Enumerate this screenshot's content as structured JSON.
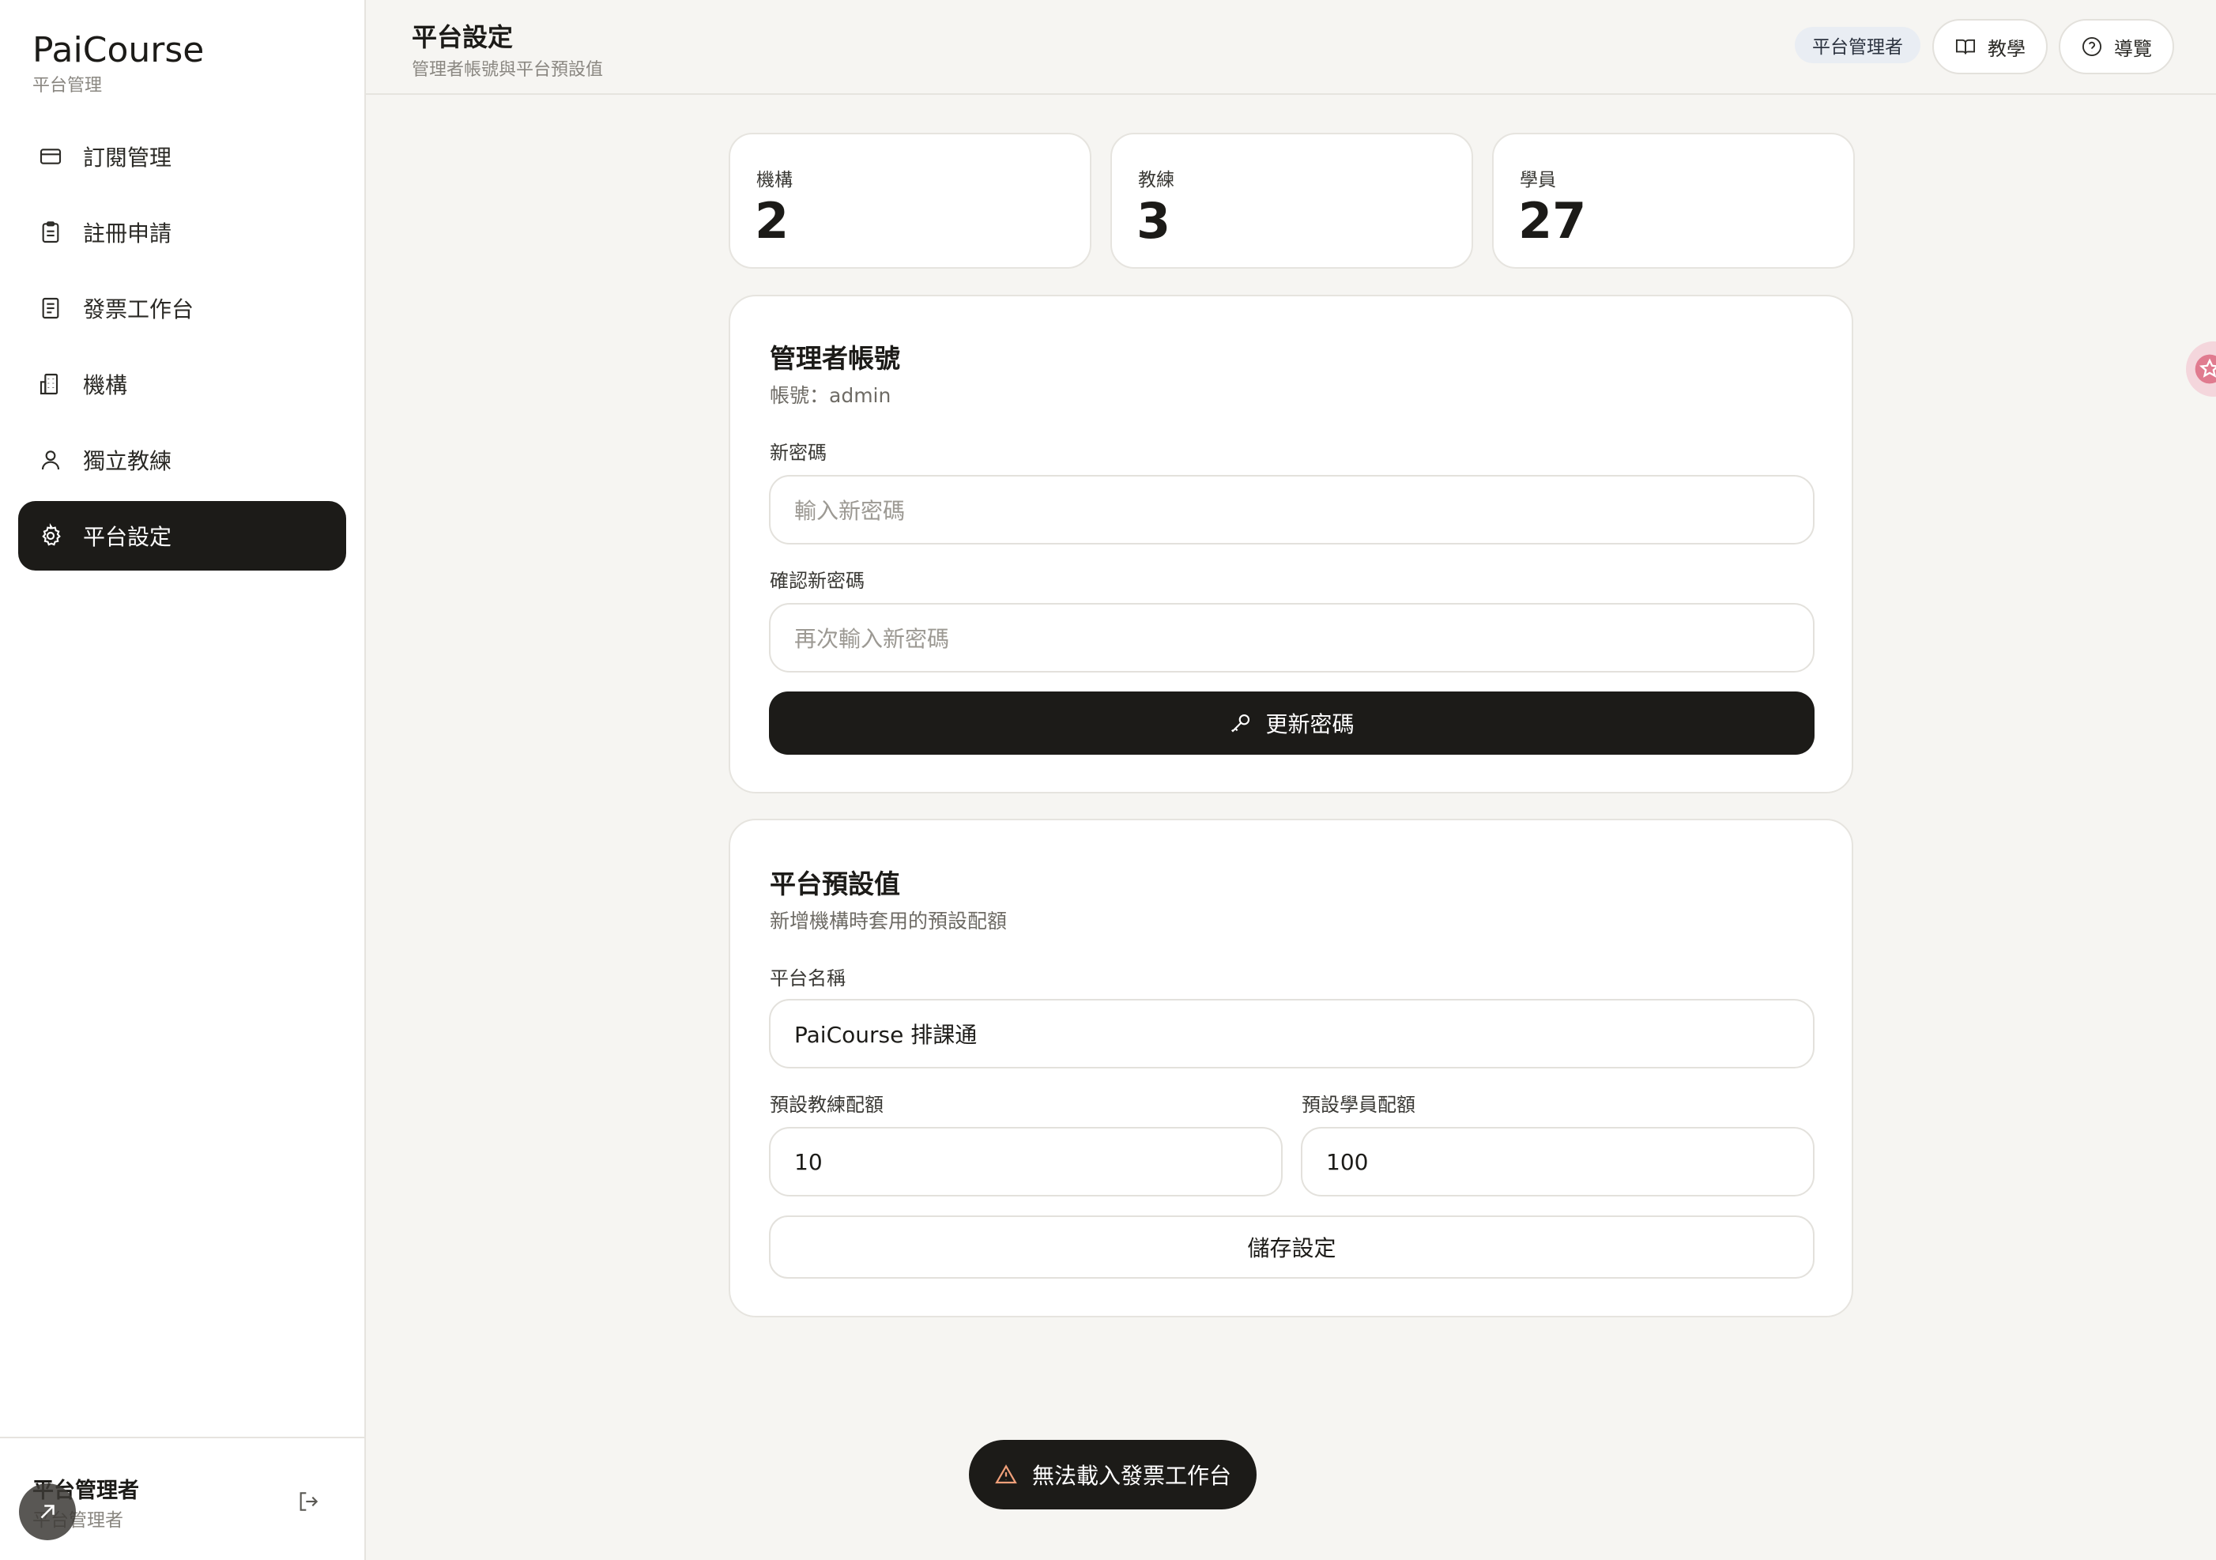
{
  "brand": {
    "title": "PaiCourse",
    "subtitle": "平台管理"
  },
  "sidebar": {
    "items": [
      {
        "label": "訂閱管理",
        "icon": "credit-card-icon",
        "active": false
      },
      {
        "label": "註冊申請",
        "icon": "clipboard-icon",
        "active": false
      },
      {
        "label": "發票工作台",
        "icon": "document-icon",
        "active": false
      },
      {
        "label": "機構",
        "icon": "building-icon",
        "active": false
      },
      {
        "label": "獨立教練",
        "icon": "user-icon",
        "active": false
      },
      {
        "label": "平台設定",
        "icon": "gear-icon",
        "active": true
      }
    ],
    "footer": {
      "name": "平台管理者",
      "role": "平台管理者"
    }
  },
  "header": {
    "title": "平台設定",
    "subtitle": "管理者帳號與平台預設值",
    "badge": "平台管理者",
    "tutorial_label": "教學",
    "tour_label": "導覽"
  },
  "stats": [
    {
      "label": "機構",
      "value": "2"
    },
    {
      "label": "教練",
      "value": "3"
    },
    {
      "label": "學員",
      "value": "27"
    }
  ],
  "admin_account": {
    "title": "管理者帳號",
    "account_line": "帳號：admin",
    "new_password_label": "新密碼",
    "new_password_placeholder": "輸入新密碼",
    "confirm_password_label": "確認新密碼",
    "confirm_password_placeholder": "再次輸入新密碼",
    "update_button": "更新密碼"
  },
  "platform_defaults": {
    "title": "平台預設值",
    "description": "新增機構時套用的預設配額",
    "platform_name_label": "平台名稱",
    "platform_name_value": "PaiCourse 排課通",
    "coach_quota_label": "預設教練配額",
    "coach_quota_value": "10",
    "student_quota_label": "預設學員配額",
    "student_quota_value": "100",
    "save_button": "儲存設定"
  },
  "toast": {
    "message": "無法載入發票工作台",
    "icon": "warning-icon"
  },
  "colors": {
    "primary": "#1c1b18",
    "background": "#f6f5f2",
    "badge_bg": "#e9edf3",
    "toast_icon": "#f0a07a"
  }
}
